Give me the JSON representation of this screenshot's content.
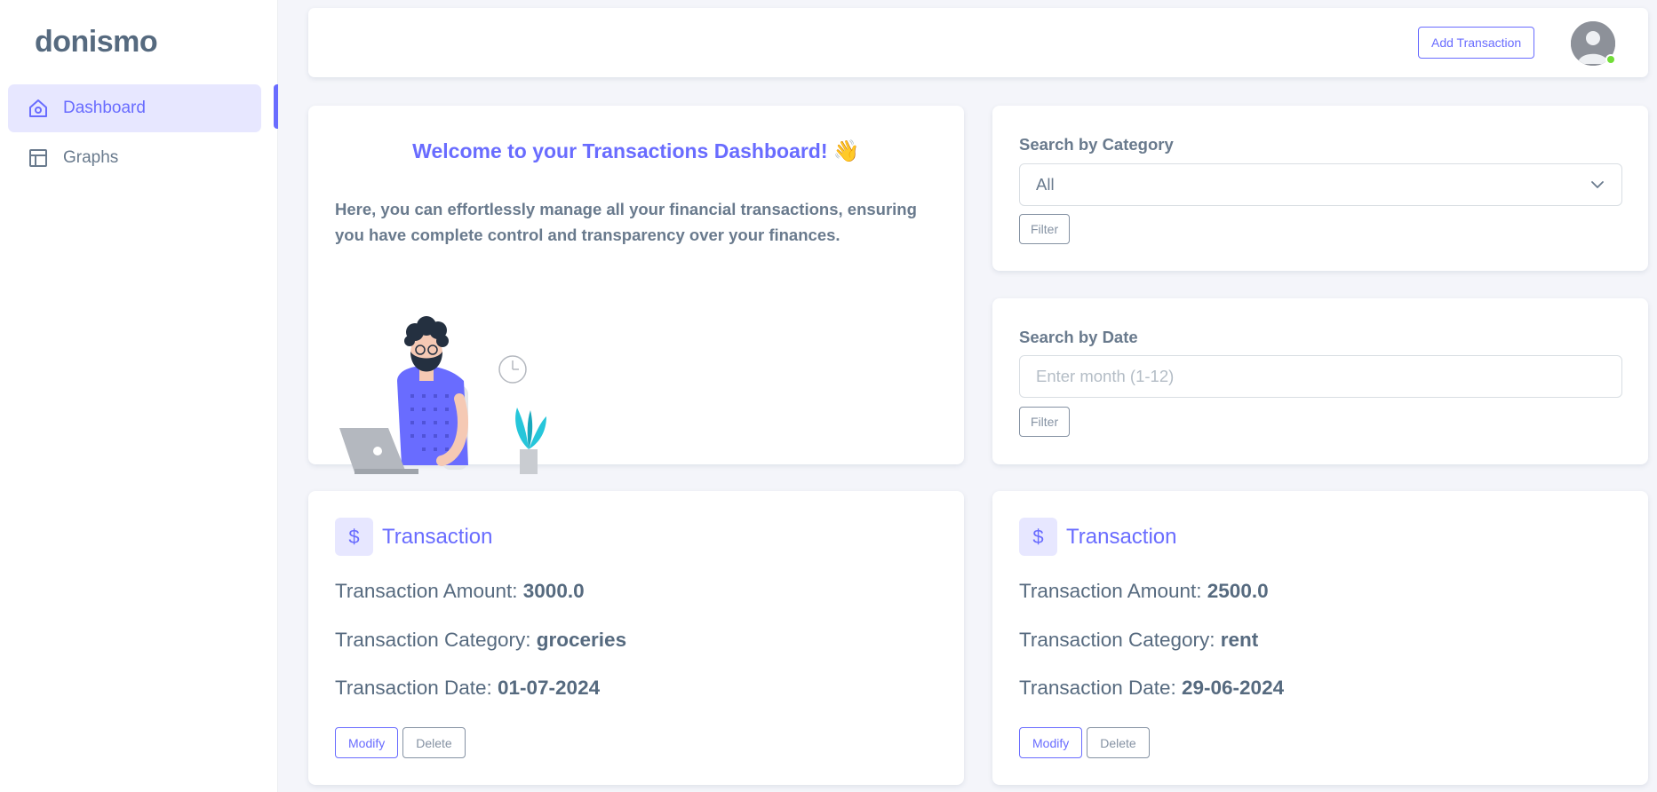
{
  "brand": "donismo",
  "sidebar": {
    "items": [
      {
        "label": "Dashboard",
        "icon": "home-icon",
        "active": true
      },
      {
        "label": "Graphs",
        "icon": "layout-icon",
        "active": false
      }
    ]
  },
  "navbar": {
    "add_transaction_label": "Add Transaction",
    "avatar_status": "online"
  },
  "welcome": {
    "title": "Welcome to your Transactions Dashboard!",
    "emoji": "👋",
    "text": "Here, you can effortlessly manage all your financial transactions, ensuring you have complete control and transparency over your finances."
  },
  "search_category": {
    "label": "Search by Category",
    "selected": "All",
    "filter_label": "Filter"
  },
  "search_date": {
    "label": "Search by Date",
    "placeholder": "Enter month (1-12)",
    "value": "",
    "filter_label": "Filter"
  },
  "transactions": [
    {
      "icon_glyph": "$",
      "title": "Transaction",
      "amount_label": "Transaction Amount: ",
      "amount": "3000.0",
      "category_label": "Transaction Category: ",
      "category": "groceries",
      "date_label": "Transaction Date: ",
      "date": "01-07-2024",
      "modify_label": "Modify",
      "delete_label": "Delete"
    },
    {
      "icon_glyph": "$",
      "title": "Transaction",
      "amount_label": "Transaction Amount: ",
      "amount": "2500.0",
      "category_label": "Transaction Category: ",
      "category": "rent",
      "date_label": "Transaction Date: ",
      "date": "29-06-2024",
      "modify_label": "Modify",
      "delete_label": "Delete"
    }
  ],
  "colors": {
    "primary": "#696cff",
    "primary_light": "#e7e7ff",
    "text": "#566a7f",
    "secondary": "#8592a3",
    "online": "#71dd37"
  }
}
